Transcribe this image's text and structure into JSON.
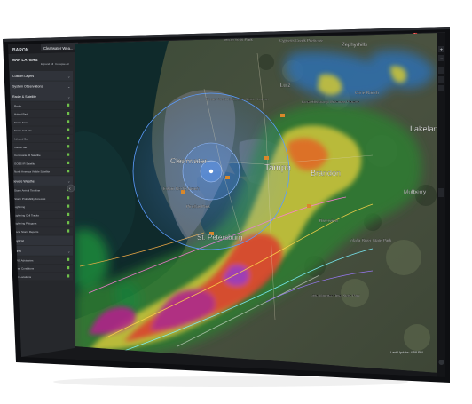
{
  "app": {
    "logo_text": "BARON",
    "tab_title": "Clearwater Wea..."
  },
  "sidebar": {
    "header": "MAP LAYERS",
    "tools": {
      "expand": "Expand All",
      "collapse": "Collapse All"
    },
    "items": [
      {
        "label": "Custom Layers",
        "type": "section"
      },
      {
        "label": "System Observations",
        "type": "section"
      },
      {
        "label": "Radar & Satellite",
        "type": "section"
      },
      {
        "label": "Radar",
        "type": "item"
      },
      {
        "label": "Hybrid Rad",
        "type": "item"
      },
      {
        "label": "Storm Scan",
        "type": "item"
      },
      {
        "label": "Storm Cell Info",
        "type": "item"
      },
      {
        "label": "Infrared Sat",
        "type": "item"
      },
      {
        "label": "Visible Sat",
        "type": "item"
      },
      {
        "label": "Composite IR Satellite",
        "type": "item"
      },
      {
        "label": "GOES IR Satellite",
        "type": "item"
      },
      {
        "label": "North America Visible Satellite",
        "type": "item"
      },
      {
        "label": "Severe Weather",
        "type": "section"
      },
      {
        "label": "Storm Arrival Timeline",
        "type": "item"
      },
      {
        "label": "Storm Probability Forecast",
        "type": "item"
      },
      {
        "label": "Lightning",
        "type": "item"
      },
      {
        "label": "Lightning Cell Tracks",
        "type": "item"
      },
      {
        "label": "Lightning Polygons",
        "type": "item"
      },
      {
        "label": "Local Storm Reports",
        "type": "item"
      },
      {
        "label": "Tropical",
        "type": "section"
      },
      {
        "label": "Storm",
        "type": "section"
      },
      {
        "label": "NWS Advisories",
        "type": "item"
      },
      {
        "label": "Road Conditions",
        "type": "item"
      },
      {
        "label": "Text Locations",
        "type": "item"
      }
    ]
  },
  "map": {
    "places": [
      {
        "name": "Wilderness Park",
        "size": "s"
      },
      {
        "name": "Cypress Creek Preserve",
        "size": "s"
      },
      {
        "name": "Zephyrhills",
        "size": "m"
      },
      {
        "name": "Lutz",
        "size": "m"
      },
      {
        "name": "Brooker Creek Headwaters Nature Preserve",
        "size": "s"
      },
      {
        "name": "Lower Hillsborough Wilderness Preserve",
        "size": "s"
      },
      {
        "name": "Cone Ranch",
        "size": "s"
      },
      {
        "name": "Lakeland",
        "size": "l"
      },
      {
        "name": "Clearwater",
        "size": "l"
      },
      {
        "name": "Tampa",
        "size": "l"
      },
      {
        "name": "Brandon",
        "size": "l"
      },
      {
        "name": "Indian Rocks Beach",
        "size": "s"
      },
      {
        "name": "Pinellas Park",
        "size": "s"
      },
      {
        "name": "St. Petersburg",
        "size": "l"
      },
      {
        "name": "Riverview",
        "size": "s"
      },
      {
        "name": "Mulberry",
        "size": "m"
      },
      {
        "name": "Alafia River State Park",
        "size": "s"
      },
      {
        "name": "Little Manatee River State Park",
        "size": "s"
      }
    ],
    "status_bar": "Last Update: 4:58 PM"
  },
  "colors": {
    "bezel": "#101114",
    "panel": "#2a2c30",
    "accent": "#6fc04a",
    "alert": "#e53935",
    "ring": "#5b9cff"
  }
}
